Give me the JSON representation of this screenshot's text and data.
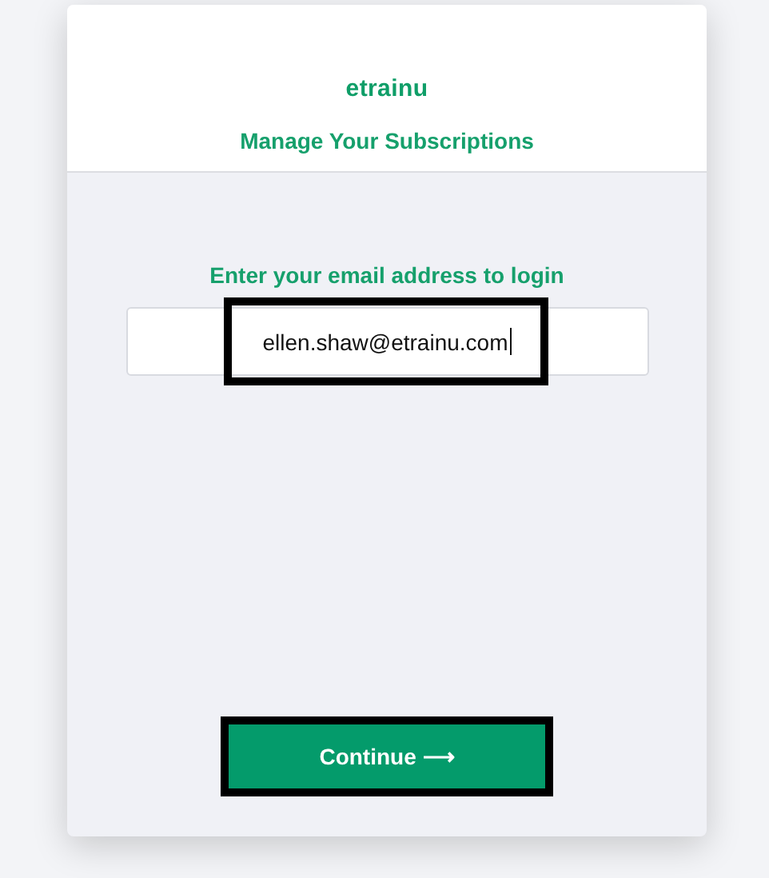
{
  "brand": "etrainu",
  "heading": "Manage Your Subscriptions",
  "prompt": "Enter your email address to login",
  "email": {
    "value": "ellen.shaw@etrainu.com",
    "focused": true,
    "highlighted": true
  },
  "continue_button": {
    "label": "Continue ⟶",
    "highlighted": true
  }
}
